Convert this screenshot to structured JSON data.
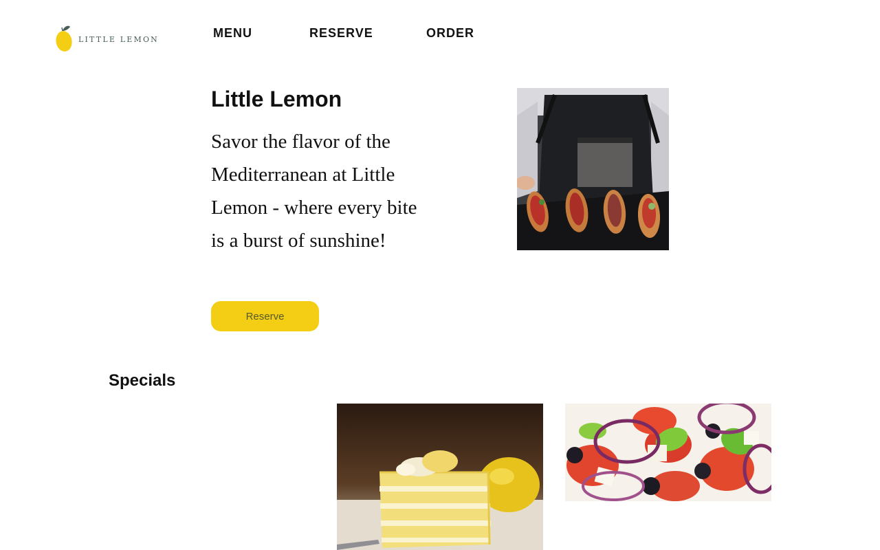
{
  "brand": {
    "logo_text": "LITTLE LEMON",
    "lemon_color": "#f4ce14",
    "leaf_color": "#495e57"
  },
  "nav": {
    "items": [
      {
        "label": "MENU"
      },
      {
        "label": "RESERVE"
      },
      {
        "label": "ORDER"
      }
    ]
  },
  "hero": {
    "title": "Little Lemon",
    "description": "Savor the flavor of the Mediterranean at Little Lemon - where every bite is a burst of sunshine!",
    "button_label": "Reserve",
    "button_color": "#f4ce14"
  },
  "specials": {
    "heading": "Specials"
  }
}
